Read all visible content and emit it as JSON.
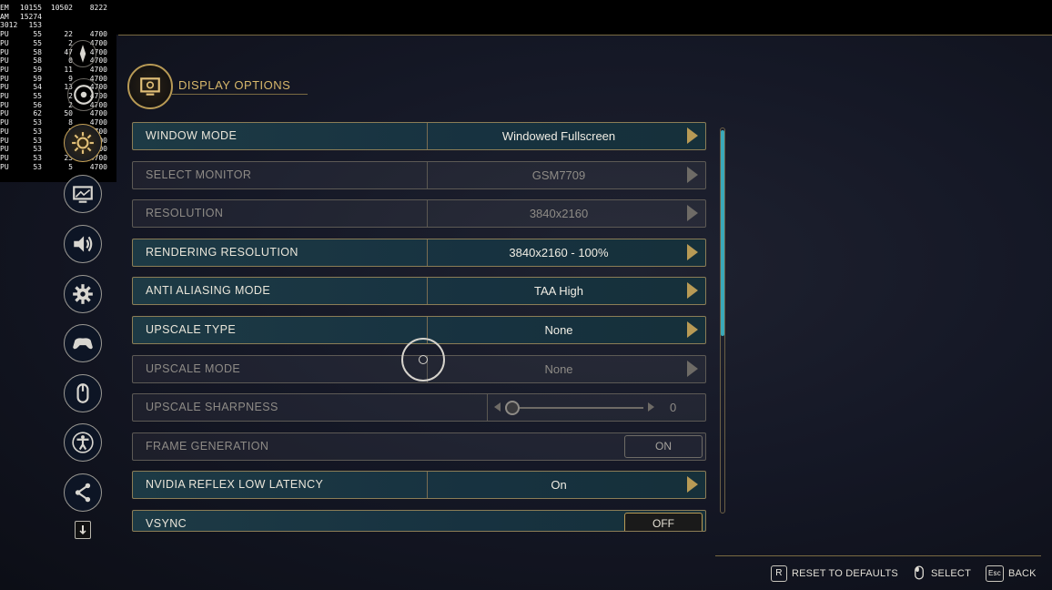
{
  "osd": {
    "rows": [
      {
        "l": "EM",
        "a": "10155",
        "b": "10502",
        "d": "8222"
      },
      {
        "l": "AM",
        "a": "15274",
        "b": "",
        "d": ""
      },
      {
        "l": "3012",
        "a": "153",
        "b": "",
        "d": ""
      },
      {
        "l": "PU",
        "a": "55",
        "b": "22",
        "d": "4700"
      },
      {
        "l": "PU",
        "a": "55",
        "b": "2",
        "d": "4700"
      },
      {
        "l": "PU",
        "a": "58",
        "b": "47",
        "d": "4700"
      },
      {
        "l": "PU",
        "a": "58",
        "b": "0",
        "d": "4700"
      },
      {
        "l": "PU",
        "a": "59",
        "b": "11",
        "d": "4700"
      },
      {
        "l": "PU",
        "a": "59",
        "b": "9",
        "d": "4700"
      },
      {
        "l": "PU",
        "a": "54",
        "b": "13",
        "d": "4700"
      },
      {
        "l": "PU",
        "a": "55",
        "b": "2",
        "d": "4700"
      },
      {
        "l": "PU",
        "a": "56",
        "b": "2",
        "d": "4700"
      },
      {
        "l": "PU",
        "a": "62",
        "b": "50",
        "d": "4700"
      },
      {
        "l": "PU",
        "a": "53",
        "b": "8",
        "d": "4700"
      },
      {
        "l": "PU",
        "a": "53",
        "b": "2",
        "d": "4700"
      },
      {
        "l": "PU",
        "a": "53",
        "b": "23",
        "d": "4700"
      },
      {
        "l": "PU",
        "a": "53",
        "b": "2",
        "d": "4700"
      },
      {
        "l": "PU",
        "a": "53",
        "b": "23",
        "d": "4700"
      },
      {
        "l": "PU",
        "a": "53",
        "b": "5",
        "d": "4700"
      }
    ]
  },
  "header": {
    "title": "DISPLAY OPTIONS"
  },
  "settings": [
    {
      "label": "WINDOW MODE",
      "value": "Windowed Fullscreen",
      "state": "active",
      "type": "select"
    },
    {
      "label": "SELECT MONITOR",
      "value": "GSM7709",
      "state": "dim",
      "type": "select"
    },
    {
      "label": "RESOLUTION",
      "value": "3840x2160",
      "state": "dim",
      "type": "select"
    },
    {
      "label": "RENDERING RESOLUTION",
      "value": "3840x2160 - 100%",
      "state": "active",
      "type": "select"
    },
    {
      "label": "ANTI ALIASING MODE",
      "value": "TAA High",
      "state": "active",
      "type": "select"
    },
    {
      "label": "UPSCALE TYPE",
      "value": "None",
      "state": "active",
      "type": "select"
    },
    {
      "label": "UPSCALE MODE",
      "value": "None",
      "state": "dim",
      "type": "select"
    },
    {
      "label": "UPSCALE SHARPNESS",
      "value": "0",
      "state": "dim",
      "type": "slider",
      "level": 0
    },
    {
      "label": "FRAME GENERATION",
      "value": "ON",
      "state": "dim",
      "type": "toggle"
    },
    {
      "label": "NVIDIA REFLEX LOW LATENCY",
      "value": "On",
      "state": "active",
      "type": "select"
    },
    {
      "label": "VSYNC",
      "value": "OFF",
      "state": "active",
      "type": "toggle"
    }
  ],
  "nav": [
    {
      "name": "compass-icon"
    },
    {
      "name": "disc-icon"
    },
    {
      "name": "gear-sun-icon"
    },
    {
      "name": "display-icon"
    },
    {
      "name": "speaker-icon"
    },
    {
      "name": "gear-icon"
    },
    {
      "name": "gamepad-icon"
    },
    {
      "name": "mouse-icon"
    },
    {
      "name": "accessibility-icon"
    },
    {
      "name": "share-icon"
    },
    {
      "name": "download-icon"
    }
  ],
  "footer": {
    "reset_key": "R",
    "reset_label": "RESET TO DEFAULTS",
    "select_label": "SELECT",
    "back_key": "Esc",
    "back_label": "BACK"
  },
  "colors": {
    "accent": "#b89a55",
    "active_row": "#1d3a45",
    "scroll": "#3aa9b9"
  }
}
